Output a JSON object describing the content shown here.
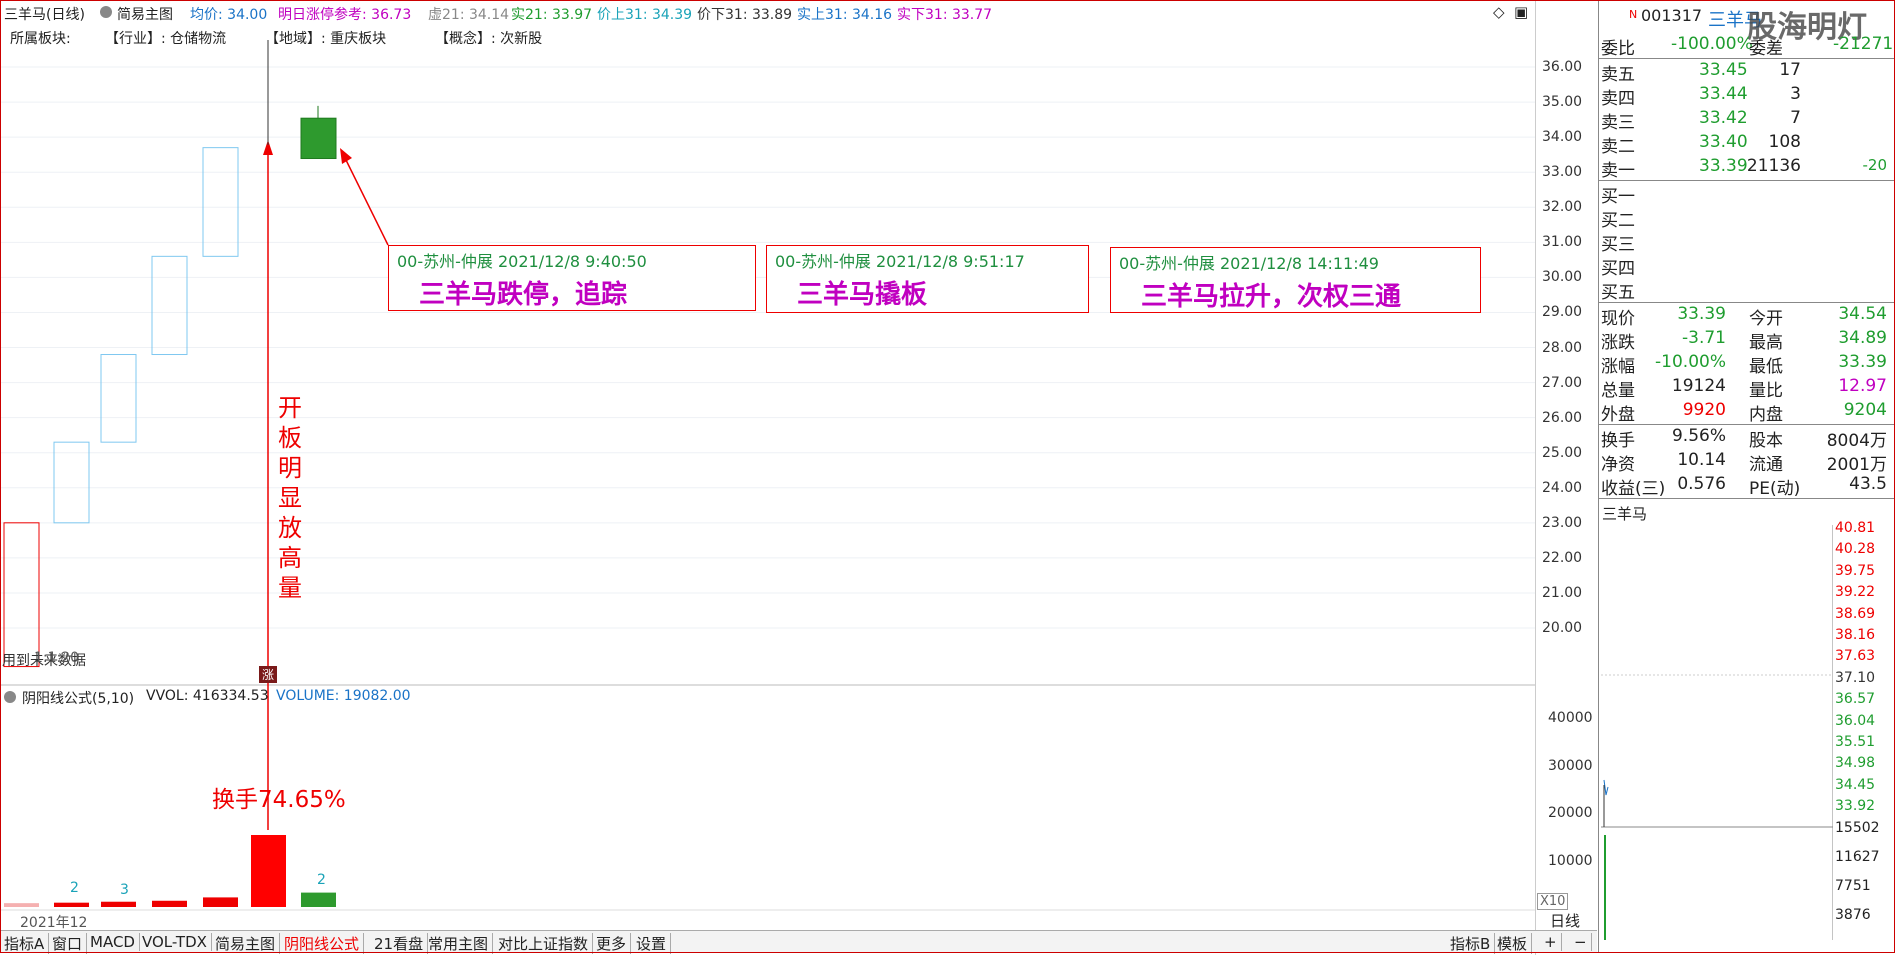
{
  "header": {
    "stock_title": "三羊马(日线)",
    "chart_mode": "简易主图",
    "avg_price": "均价: 34.00",
    "limit_ref": "明日涨停参考: 36.73",
    "virtual21": "虚21: 34.14",
    "real21": "实21: 33.97",
    "priceup31": "价上31: 34.39",
    "pricedown31": "价下31: 33.89",
    "realup31": "实上31: 34.16",
    "realdown31": "实下31: 33.77"
  },
  "sectors": {
    "label": "所属板块:",
    "industry": "【行业】: 仓储物流",
    "region": "【地域】: 重庆板块",
    "concept": "【概念】: 次新股"
  },
  "price_axis": [
    "36.00",
    "35.00",
    "34.00",
    "33.00",
    "32.00",
    "31.00",
    "30.00",
    "29.00",
    "28.00",
    "27.00",
    "26.00",
    "25.00",
    "24.00",
    "23.00",
    "22.00",
    "21.00",
    "20.00"
  ],
  "chart_labels": {
    "left_overlay": "用到未来数据",
    "left_overlay_b": "1:1:20",
    "vertical_note": "开板明显放高量",
    "turnover": "换手74.65%",
    "limit_marker": "涨",
    "date_label": "2021年12",
    "vol_count_1": "2",
    "vol_count_2": "3",
    "vol_count_3": "2"
  },
  "chart_data": {
    "type": "candlestick",
    "candles": [
      {
        "open": 18.9,
        "close": 23.0,
        "high": 23.0,
        "low": 18.9,
        "style": "hollow-red"
      },
      {
        "open": 23.0,
        "close": 25.3,
        "high": 25.3,
        "low": 23.0,
        "style": "hollow-blue"
      },
      {
        "open": 25.3,
        "close": 27.8,
        "high": 27.8,
        "low": 25.3,
        "style": "hollow-blue"
      },
      {
        "open": 27.8,
        "close": 30.6,
        "high": 30.6,
        "low": 27.8,
        "style": "hollow-blue"
      },
      {
        "open": 30.6,
        "close": 33.7,
        "high": 33.7,
        "low": 30.6,
        "style": "hollow-blue"
      },
      {
        "open": 33.7,
        "close": 37.0,
        "high": 37.0,
        "low": 33.7,
        "style": "line"
      },
      {
        "open": 34.54,
        "close": 33.39,
        "high": 34.89,
        "low": 33.39,
        "style": "solid-green"
      }
    ],
    "volume": [
      800,
      900,
      1100,
      1300,
      2000,
      15000,
      3000
    ],
    "volume_axis": [
      "40000",
      "30000",
      "20000",
      "10000"
    ],
    "ylim": [
      19.5,
      36.5
    ]
  },
  "volume_header": {
    "formula": "阴阳线公式(5,10)",
    "vvol": "VVOL: 416334.53",
    "volume": "VOLUME: 19082.00",
    "x10": "X10",
    "period": "日线"
  },
  "notes": [
    {
      "head": "00-苏州-仲展 2021/12/8 9:40:50",
      "body": "三羊马跌停，追踪"
    },
    {
      "head": "00-苏州-仲展 2021/12/8 9:51:17",
      "body": "三羊马撬板"
    },
    {
      "head": "00-苏州-仲展 2021/12/8 14:11:49",
      "body": "三羊马拉升，次权三通"
    }
  ],
  "panel": {
    "badge": "N",
    "code": "001317",
    "name": "三羊马",
    "watermark": "股海明灯",
    "weibi_label": "委比",
    "weibi_val": "-100.00%",
    "weicha_label": "委差",
    "weicha_val": "-21271",
    "sells": [
      {
        "label": "卖五",
        "price": "33.45",
        "vol": "17",
        "chg": ""
      },
      {
        "label": "卖四",
        "price": "33.44",
        "vol": "3",
        "chg": ""
      },
      {
        "label": "卖三",
        "price": "33.42",
        "vol": "7",
        "chg": ""
      },
      {
        "label": "卖二",
        "price": "33.40",
        "vol": "108",
        "chg": ""
      },
      {
        "label": "卖一",
        "price": "33.39",
        "vol": "21136",
        "chg": "-20"
      }
    ],
    "buys": [
      "买一",
      "买二",
      "买三",
      "买四",
      "买五"
    ],
    "stats": [
      {
        "l1": "现价",
        "v1": "33.39",
        "l2": "今开",
        "v2": "34.54"
      },
      {
        "l1": "涨跌",
        "v1": "-3.71",
        "l2": "最高",
        "v2": "34.89"
      },
      {
        "l1": "涨幅",
        "v1": "-10.00%",
        "l2": "最低",
        "v2": "33.39"
      },
      {
        "l1": "总量",
        "v1": "19124",
        "l2": "量比",
        "v2": "12.97"
      },
      {
        "l1": "外盘",
        "v1": "9920",
        "l2": "内盘",
        "v2": "9204"
      }
    ],
    "stats2": [
      {
        "l1": "换手",
        "v1": "9.56%",
        "l2": "股本",
        "v2": "8004万"
      },
      {
        "l1": "净资",
        "v1": "10.14",
        "l2": "流通",
        "v2": "2001万"
      },
      {
        "l1": "收益(三)",
        "v1": "0.576",
        "l2": "PE(动)",
        "v2": "43.5"
      }
    ],
    "mini_title": "三羊马",
    "mini_axis": [
      "40.81",
      "40.28",
      "39.75",
      "39.22",
      "38.69",
      "38.16",
      "37.63",
      "37.10",
      "36.57",
      "36.04",
      "35.51",
      "34.98",
      "34.45",
      "33.92"
    ],
    "mini_vol_axis": [
      "15502",
      "11627",
      "7751",
      "3876"
    ]
  },
  "tabs": [
    "指标A",
    "窗口",
    "MACD",
    "VOL-TDX",
    "简易主图",
    "阴阳线公式",
    "21看盘",
    "常用主图",
    "对比上证指数",
    "更多",
    "设置"
  ],
  "tabs_right": [
    "指标B",
    "模板",
    "+",
    "−"
  ]
}
